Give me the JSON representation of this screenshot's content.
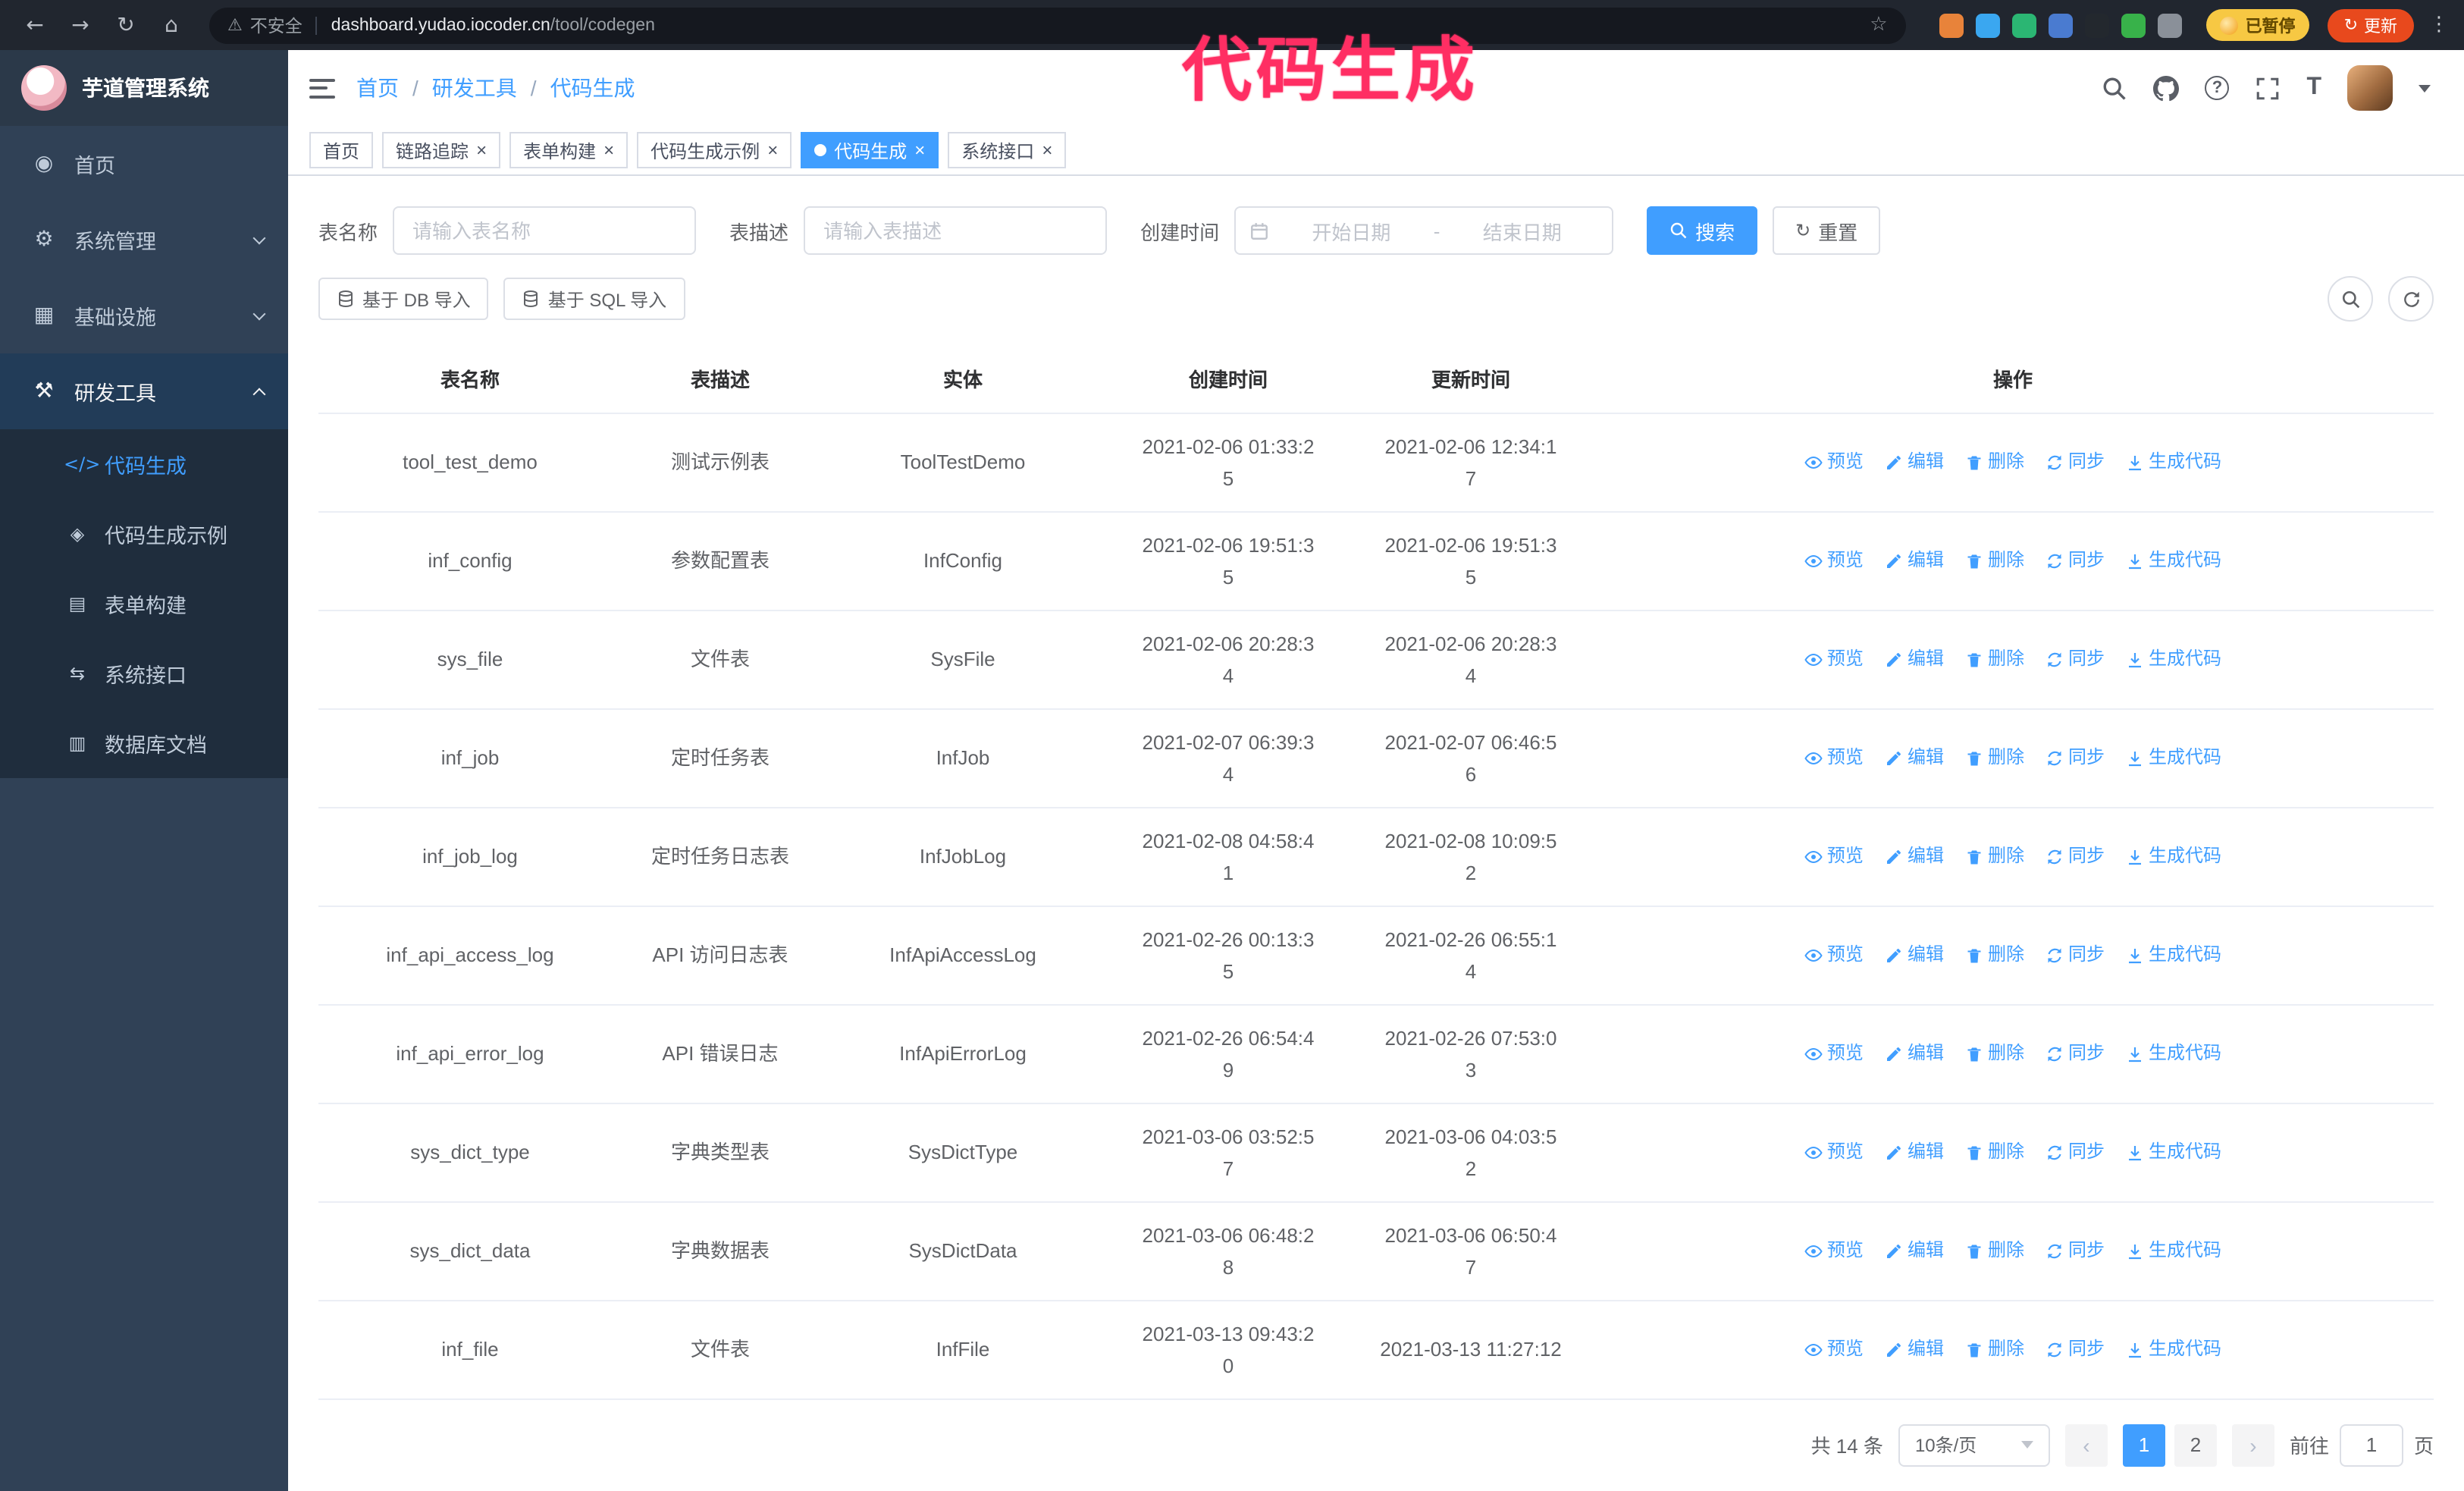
{
  "annotation": {
    "text": "代码生成",
    "color": "#ff2e63"
  },
  "glyphs": {
    "back": "←",
    "forward": "→",
    "reload": "↻",
    "home": "⌂",
    "warning": "⚠",
    "star": "☆",
    "kebab": "⋮",
    "update": "↻",
    "question": "?",
    "fontsize": "T",
    "reset": "↻",
    "close": "×",
    "prev": "‹",
    "next": "›"
  },
  "browser": {
    "security_label": "不安全",
    "url_host": "dashboard.yudao.iocoder.cn",
    "url_path": "/tool/codegen",
    "paused_badge": "已暂停",
    "update_button": "更新",
    "extensions": [
      {
        "id": "extension-orange-icon",
        "color": "#e8833a"
      },
      {
        "id": "extension-blue-icon",
        "color": "#3aa7f0"
      },
      {
        "id": "extension-green-icon",
        "color": "#2bb673"
      },
      {
        "id": "extension-indigo-icon",
        "color": "#4a7bd0"
      },
      {
        "id": "extension-dark-icon",
        "color": "#23282e"
      },
      {
        "id": "extension-leaf-icon",
        "color": "#38b24a"
      },
      {
        "id": "extension-grey-icon",
        "color": "#8a9099"
      }
    ]
  },
  "sidebar": {
    "logo_title": "芋道管理系统",
    "items": [
      {
        "id": "home",
        "label": "首页",
        "icon": "dashboard-icon",
        "glyph": "◉"
      },
      {
        "id": "system",
        "label": "系统管理",
        "icon": "gear-icon",
        "glyph": "⚙",
        "expandable": true
      },
      {
        "id": "infra",
        "label": "基础设施",
        "icon": "infra-icon",
        "glyph": "▦",
        "expandable": true
      },
      {
        "id": "devtools",
        "label": "研发工具",
        "icon": "tools-icon",
        "glyph": "⚒",
        "expandable": true,
        "expanded": true,
        "highlighted": true,
        "children": [
          {
            "id": "codegen",
            "label": "代码生成",
            "icon": "code-icon",
            "glyph": "</>",
            "active": true
          },
          {
            "id": "codegen-example",
            "label": "代码生成示例",
            "icon": "example-icon",
            "glyph": "◈"
          },
          {
            "id": "form-builder",
            "label": "表单构建",
            "icon": "form-icon",
            "glyph": "▤"
          },
          {
            "id": "system-api",
            "label": "系统接口",
            "icon": "api-icon",
            "glyph": "⇆"
          },
          {
            "id": "db-doc",
            "label": "数据库文档",
            "icon": "database-doc-icon",
            "glyph": "▥"
          }
        ]
      }
    ]
  },
  "header": {
    "breadcrumb": [
      "首页",
      "研发工具",
      "代码生成"
    ],
    "separator": "/"
  },
  "tabs": [
    {
      "id": "home",
      "label": "首页",
      "closable": false
    },
    {
      "id": "tracing",
      "label": "链路追踪",
      "closable": true
    },
    {
      "id": "form-builder",
      "label": "表单构建",
      "closable": true
    },
    {
      "id": "codegen-example",
      "label": "代码生成示例",
      "closable": true
    },
    {
      "id": "codegen",
      "label": "代码生成",
      "closable": true,
      "active": true
    },
    {
      "id": "system-api",
      "label": "系统接口",
      "closable": true
    }
  ],
  "filters": {
    "table_name_label": "表名称",
    "table_name_placeholder": "请输入表名称",
    "table_desc_label": "表描述",
    "table_desc_placeholder": "请输入表描述",
    "create_time_label": "创建时间",
    "date_start_placeholder": "开始日期",
    "date_separator": "-",
    "date_end_placeholder": "结束日期",
    "search_button": "搜索",
    "reset_button": "重置"
  },
  "toolbar": {
    "import_db": "基于 DB 导入",
    "import_sql": "基于 SQL 导入"
  },
  "table": {
    "columns": [
      "表名称",
      "表描述",
      "实体",
      "创建时间",
      "更新时间",
      "操作"
    ],
    "row_actions": [
      {
        "id": "preview",
        "label": "预览",
        "icon": "eye-icon"
      },
      {
        "id": "edit",
        "label": "编辑",
        "icon": "edit-icon"
      },
      {
        "id": "delete",
        "label": "删除",
        "icon": "trash-icon"
      },
      {
        "id": "sync",
        "label": "同步",
        "icon": "sync-icon"
      },
      {
        "id": "generate-code",
        "label": "生成代码",
        "icon": "download-icon"
      }
    ],
    "rows": [
      {
        "name": "tool_test_demo",
        "desc": "测试示例表",
        "entity": "ToolTestDemo",
        "created": "2021-02-06 01:33:25",
        "updated": "2021-02-06 12:34:17"
      },
      {
        "name": "inf_config",
        "desc": "参数配置表",
        "entity": "InfConfig",
        "created": "2021-02-06 19:51:35",
        "updated": "2021-02-06 19:51:35"
      },
      {
        "name": "sys_file",
        "desc": "文件表",
        "entity": "SysFile",
        "created": "2021-02-06 20:28:34",
        "updated": "2021-02-06 20:28:34"
      },
      {
        "name": "inf_job",
        "desc": "定时任务表",
        "entity": "InfJob",
        "created": "2021-02-07 06:39:34",
        "updated": "2021-02-07 06:46:56"
      },
      {
        "name": "inf_job_log",
        "desc": "定时任务日志表",
        "entity": "InfJobLog",
        "created": "2021-02-08 04:58:41",
        "updated": "2021-02-08 10:09:52"
      },
      {
        "name": "inf_api_access_log",
        "desc": "API 访问日志表",
        "entity": "InfApiAccessLog",
        "created": "2021-02-26 00:13:35",
        "updated": "2021-02-26 06:55:14"
      },
      {
        "name": "inf_api_error_log",
        "desc": "API 错误日志",
        "entity": "InfApiErrorLog",
        "created": "2021-02-26 06:54:49",
        "updated": "2021-02-26 07:53:03"
      },
      {
        "name": "sys_dict_type",
        "desc": "字典类型表",
        "entity": "SysDictType",
        "created": "2021-03-06 03:52:57",
        "updated": "2021-03-06 04:03:52"
      },
      {
        "name": "sys_dict_data",
        "desc": "字典数据表",
        "entity": "SysDictData",
        "created": "2021-03-06 06:48:28",
        "updated": "2021-03-06 06:50:47"
      },
      {
        "name": "inf_file",
        "desc": "文件表",
        "entity": "InfFile",
        "created": "2021-03-13 09:43:20",
        "updated": "2021-03-13 11:27:12"
      }
    ]
  },
  "pagination": {
    "total_text": "共 14 条",
    "page_size": "10条/页",
    "pages": [
      "1",
      "2"
    ],
    "active_page": "1",
    "goto_prefix": "前往",
    "goto_value": "1",
    "goto_suffix": "页"
  },
  "colors": {
    "primary": "#409eff",
    "link": "#409eff",
    "sidebar_bg": "#304156",
    "submenu_bg": "#1f2d3d",
    "sidebar_text": "#bfcbd9",
    "annotation": "#ff2e63",
    "chrome_bg": "#21262f",
    "update_button_bg": "#e8491d",
    "paused_badge_bg": "#f7c843"
  }
}
